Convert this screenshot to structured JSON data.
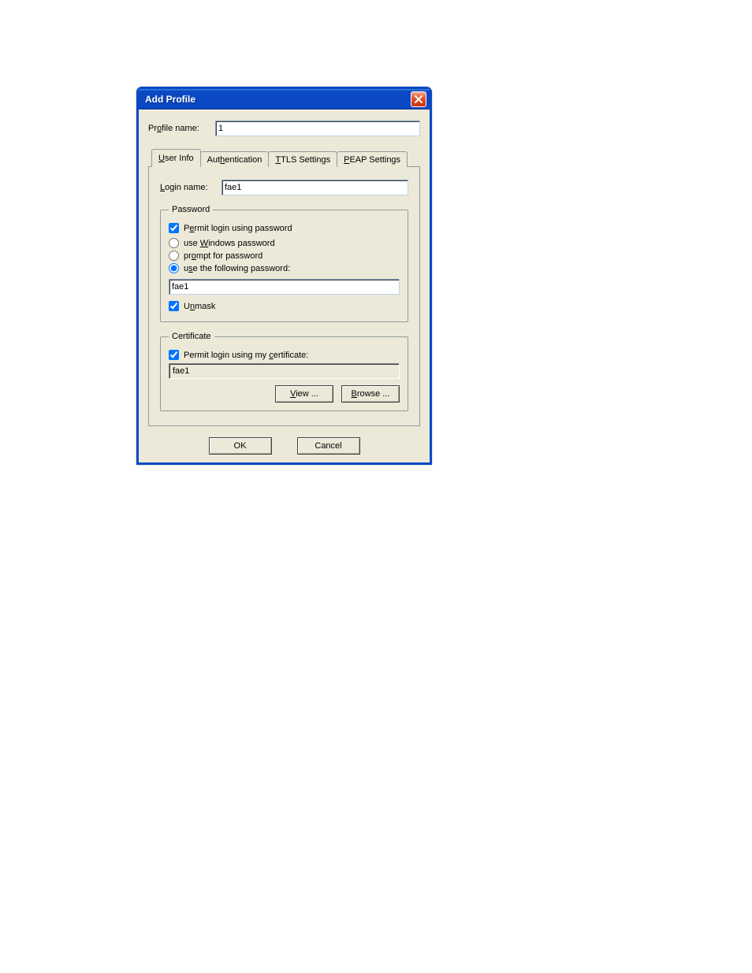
{
  "title": "Add Profile",
  "profile_name_label": "Profile name:",
  "profile_name_value": "1",
  "tabs": {
    "user_info_pre": "U",
    "user_info_post": "ser Info",
    "auth_pre": "Aut",
    "auth_hot": "h",
    "auth_post": "entication",
    "ttls_hot": "T",
    "ttls_post": "TLS Settings",
    "peap_hot": "P",
    "peap_post": "EAP Settings"
  },
  "login_name_label_pre": "L",
  "login_name_label_post": "ogin name:",
  "login_name_value": "fae1",
  "password": {
    "legend": "Password",
    "permit_pre": "P",
    "permit_hot": "e",
    "permit_post": "rmit login using password",
    "use_win_pre": "use ",
    "use_win_hot": "W",
    "use_win_post": "indows password",
    "prompt_pre": "pr",
    "prompt_hot": "o",
    "prompt_post": "mpt for password",
    "use_following_pre": "u",
    "use_following_hot": "s",
    "use_following_post": "e the following password:",
    "value": "fae1",
    "unmask_pre": "U",
    "unmask_hot": "n",
    "unmask_post": "mask"
  },
  "certificate": {
    "legend": "Certificate",
    "permit_pre": "Permit login using my ",
    "permit_hot": "c",
    "permit_post": "ertificate:",
    "value": "fae1",
    "view_hot": "V",
    "view_post": "iew ...",
    "browse_hot": "B",
    "browse_post": "rowse ..."
  },
  "buttons": {
    "ok": "OK",
    "cancel": "Cancel"
  }
}
